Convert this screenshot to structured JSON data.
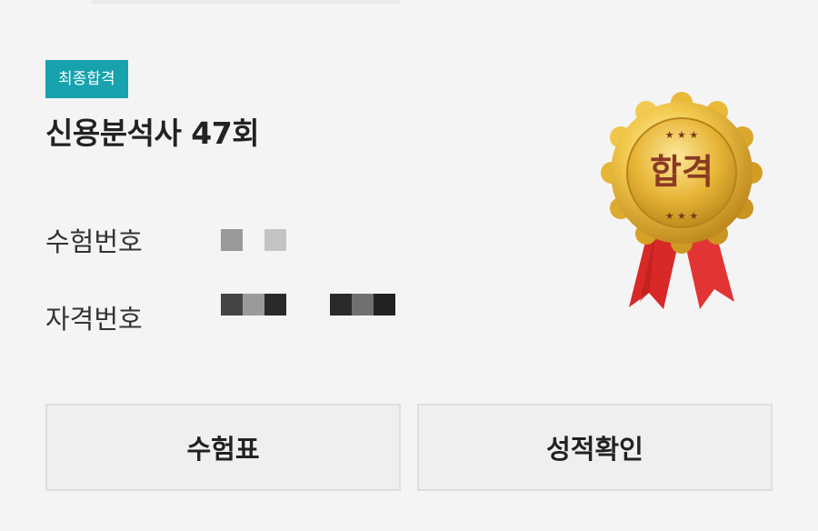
{
  "status_badge": "최종합격",
  "exam_title": "신용분석사 47회",
  "fields": {
    "exam_number_label": "수험번호",
    "license_number_label": "자격번호"
  },
  "medal": {
    "text": "합격",
    "icon": "pass-medal-icon",
    "colors": {
      "gold": "#e6b422",
      "ribbon": "#e02a2a"
    }
  },
  "buttons": {
    "admission_ticket": "수험표",
    "check_score": "성적확인"
  },
  "colors": {
    "badge": "#17a2ae",
    "background": "#f4f4f4"
  }
}
